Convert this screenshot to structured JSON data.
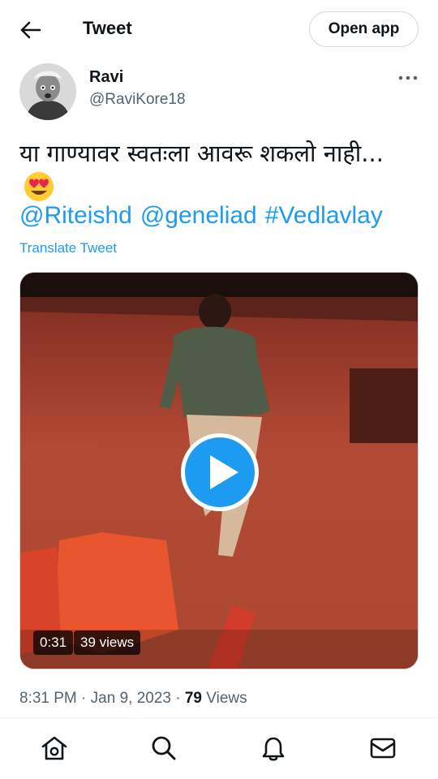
{
  "header": {
    "title": "Tweet",
    "open_app_label": "Open app"
  },
  "author": {
    "name": "Ravi",
    "handle": "@RaviKore18"
  },
  "tweet": {
    "text": "या गाण्यावर स्वतःला आवरू शकलो नाही...",
    "emoji": "smiling-face-with-heart-eyes",
    "tags": [
      "@Riteishd",
      "@geneliad",
      "#Vedlavlay"
    ],
    "translate_label": "Translate Tweet"
  },
  "video": {
    "duration": "0:31",
    "views_label": "39 views"
  },
  "meta": {
    "time": "8:31 PM",
    "sep": "·",
    "date": "Jan 9, 2023",
    "views_count": "79",
    "views_label": "Views"
  },
  "nav": [
    "home-icon",
    "search-icon",
    "bell-icon",
    "mail-icon"
  ],
  "colors": {
    "accent": "#1d9bf0",
    "text": "#0f1419",
    "muted": "#536471"
  }
}
